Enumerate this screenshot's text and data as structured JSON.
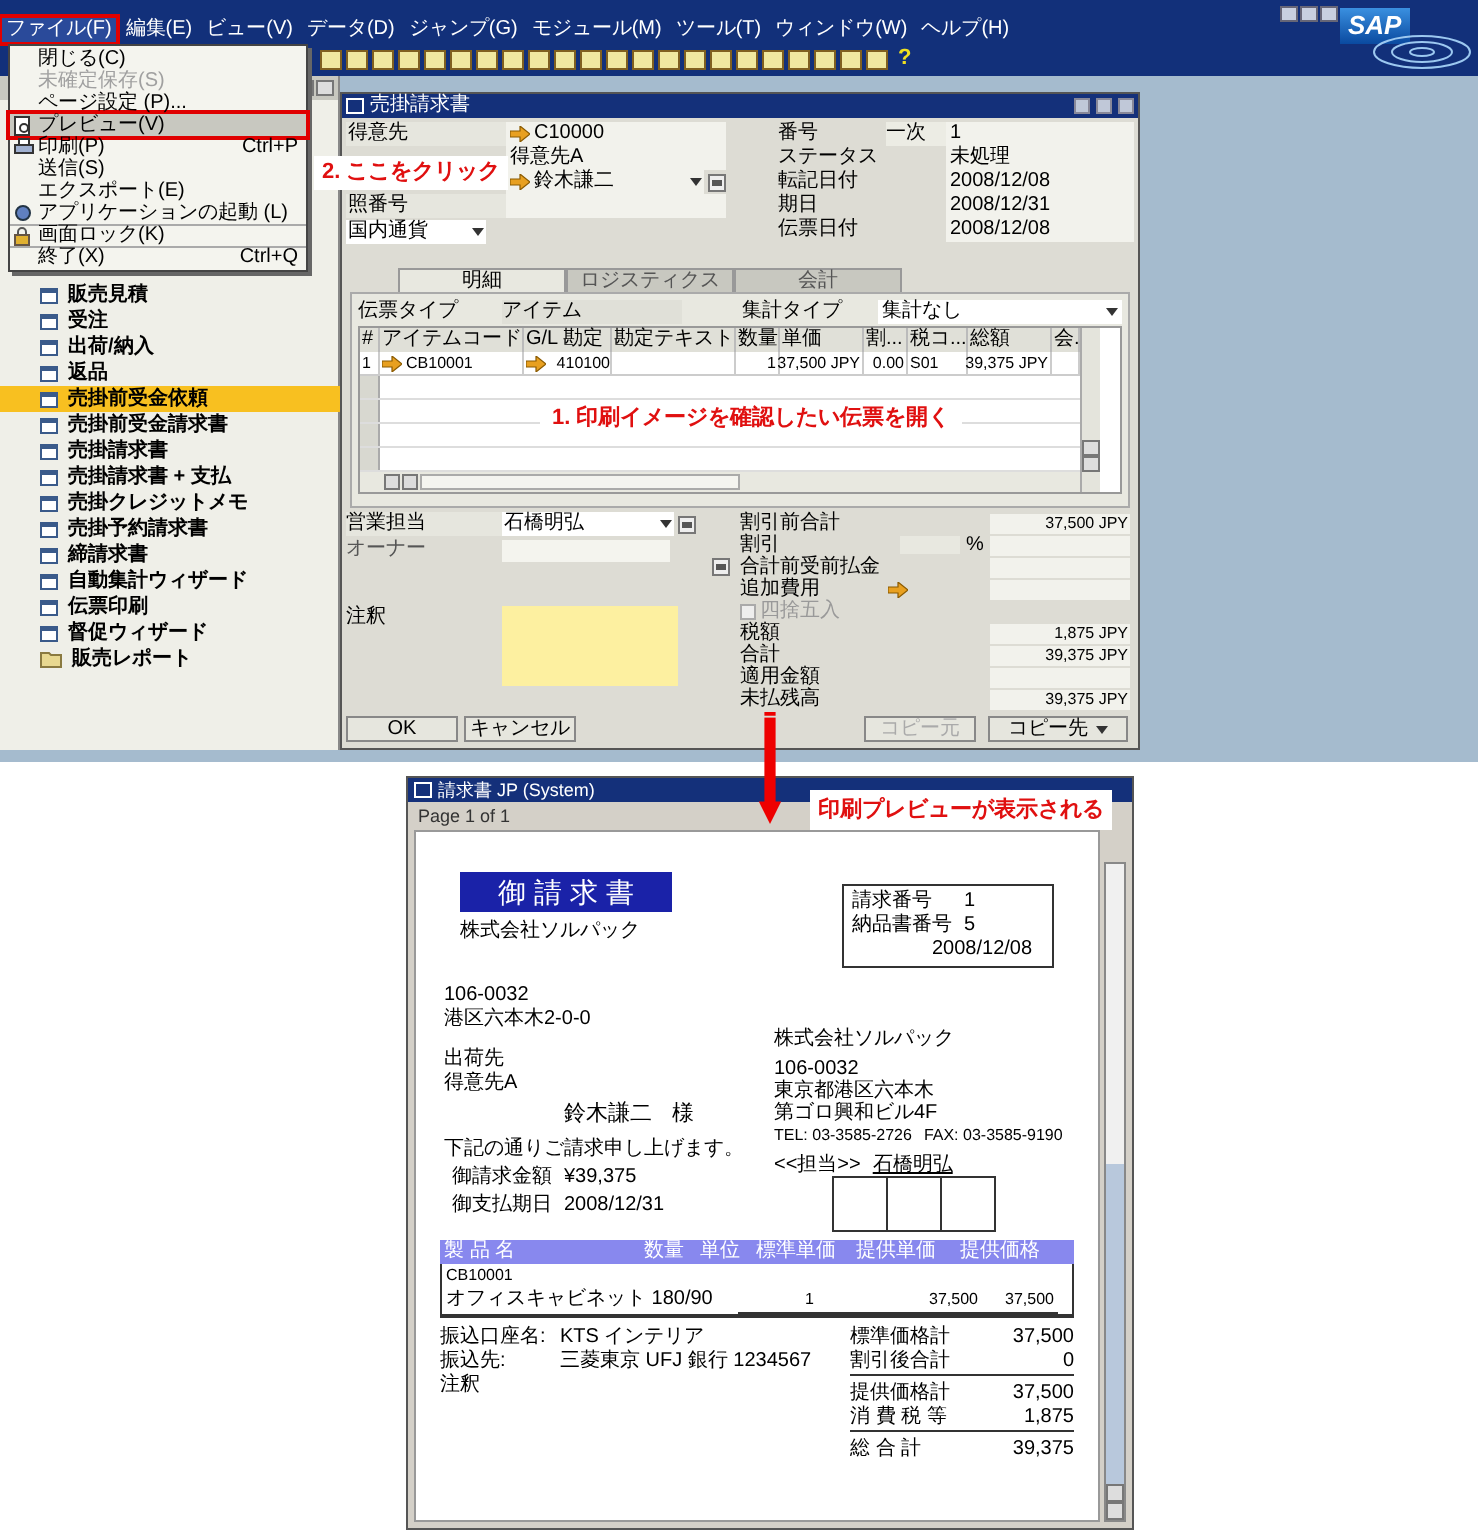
{
  "app": {
    "logo": "SAP",
    "help_glyph": "?",
    "menu": [
      {
        "label": "ファイル(F)",
        "selected": true
      },
      {
        "label": "編集(E)",
        "selected": false
      },
      {
        "label": "ビュー(V)",
        "selected": false
      },
      {
        "label": "データ(D)",
        "selected": false
      },
      {
        "label": "ジャンプ(G)",
        "selected": false
      },
      {
        "label": "モジュール(M)",
        "selected": false
      },
      {
        "label": "ツール(T)",
        "selected": false
      },
      {
        "label": "ウィンドウ(W)",
        "selected": false
      },
      {
        "label": "ヘルプ(H)",
        "selected": false
      }
    ],
    "file_menu": [
      {
        "label": "閉じる(C)",
        "kind": "plain",
        "disabled": false,
        "selected": false
      },
      {
        "label": "未確定保存(S)",
        "kind": "plain",
        "disabled": true,
        "selected": false
      },
      {
        "label": "ページ設定 (P)...",
        "kind": "plain",
        "disabled": false,
        "selected": false
      },
      {
        "label": "プレビュー(V)",
        "kind": "preview",
        "disabled": false,
        "selected": true
      },
      {
        "label": "印刷(P)",
        "shortcut": "Ctrl+P",
        "kind": "print",
        "disabled": false,
        "selected": false
      },
      {
        "label": "送信(S)",
        "kind": "plain",
        "disabled": false,
        "selected": false
      },
      {
        "label": "エクスポート(E)",
        "kind": "plain",
        "disabled": false,
        "selected": false
      },
      {
        "label": "アプリケーションの起動 (L)",
        "kind": "app",
        "disabled": false,
        "selected": false
      },
      {
        "label": "画面ロック(K)",
        "kind": "lock",
        "disabled": false,
        "selected": false
      },
      {
        "label": "終了(X)",
        "shortcut": "Ctrl+Q",
        "kind": "plain",
        "disabled": false,
        "selected": false
      }
    ],
    "sidebar": [
      {
        "label": "販売見積",
        "kind": "doc",
        "selected": false
      },
      {
        "label": "受注",
        "kind": "doc",
        "selected": false
      },
      {
        "label": "出荷/納入",
        "kind": "doc",
        "selected": false
      },
      {
        "label": "返品",
        "kind": "doc",
        "selected": false
      },
      {
        "label": "売掛前受金依頼",
        "kind": "doc",
        "selected": true
      },
      {
        "label": "売掛前受金請求書",
        "kind": "doc",
        "selected": false
      },
      {
        "label": "売掛請求書",
        "kind": "doc",
        "selected": false
      },
      {
        "label": "売掛請求書 + 支払",
        "kind": "doc",
        "selected": false
      },
      {
        "label": "売掛クレジットメモ",
        "kind": "doc",
        "selected": false
      },
      {
        "label": "売掛予約請求書",
        "kind": "doc",
        "selected": false
      },
      {
        "label": "締請求書",
        "kind": "doc",
        "selected": false
      },
      {
        "label": "自動集計ウィザード",
        "kind": "doc",
        "selected": false
      },
      {
        "label": "伝票印刷",
        "kind": "doc",
        "selected": false
      },
      {
        "label": "督促ウィザード",
        "kind": "doc",
        "selected": false
      },
      {
        "label": "販売レポート",
        "kind": "folder",
        "selected": false
      }
    ]
  },
  "invoice_window": {
    "title": "売掛請求書",
    "left_fields": [
      {
        "label": "得意先",
        "value": "C10000",
        "link": true
      },
      {
        "value": "得意先A",
        "link": false
      },
      {
        "value": "鈴木謙二",
        "link": true,
        "dropdown": true
      },
      {
        "label": "照番号",
        "link": false
      }
    ],
    "currency": "国内通貨",
    "right_fields": [
      {
        "label": "番号",
        "series": "一次",
        "value": "1"
      },
      {
        "label": "ステータス",
        "value": "未処理"
      },
      {
        "label": "転記日付",
        "value": "2008/12/08"
      },
      {
        "label": "期日",
        "value": "2008/12/31"
      },
      {
        "label": "伝票日付",
        "value": "2008/12/08"
      }
    ],
    "tabs": [
      {
        "label": "明細",
        "selected": true
      },
      {
        "label": "ロジスティクス",
        "selected": false
      },
      {
        "label": "会計",
        "selected": false
      }
    ],
    "doc_type_label": "伝票タイプ",
    "doc_type": "アイテム",
    "summary_type_label": "集計タイプ",
    "summary_type": "集計なし",
    "columns": [
      "#",
      "アイテムコード",
      "G/L 勘定",
      "勘定テキスト",
      "数量",
      "単価",
      "割...",
      "税コ...",
      "総額",
      "会."
    ],
    "rows": [
      {
        "cells": [
          "1",
          "CB10001",
          "410100",
          "",
          "1",
          "37,500 JPY",
          "0.00",
          "S01",
          "39,375 JPY",
          ""
        ]
      }
    ],
    "sales_rep_label": "営業担当",
    "sales_rep": "石橋明弘",
    "owner_label": "オーナー",
    "remarks_label": "注釈",
    "totals": [
      {
        "label": "割引前合計",
        "value": "37,500 JPY",
        "kind": "amount"
      },
      {
        "label": "割引",
        "unit": "%",
        "kind": "percent"
      },
      {
        "label": "合計前受前払金",
        "kind": "button"
      },
      {
        "label": "追加費用",
        "kind": "link"
      },
      {
        "label": "四捨五入",
        "checked": false,
        "kind": "check"
      },
      {
        "label": "税額",
        "value": "1,875 JPY",
        "kind": "amount"
      },
      {
        "label": "合計",
        "value": "39,375 JPY",
        "kind": "amount"
      },
      {
        "label": "適用金額",
        "kind": "amount"
      },
      {
        "label": "未払残高",
        "value": "39,375 JPY",
        "kind": "amount"
      }
    ],
    "buttons": [
      {
        "label": "OK",
        "disabled": false,
        "dropdown": false
      },
      {
        "label": "キャンセル",
        "disabled": false,
        "dropdown": false
      },
      {
        "label": "コピー元",
        "disabled": true,
        "dropdown": false
      },
      {
        "label": "コピー先",
        "disabled": false,
        "dropdown": true
      }
    ]
  },
  "annotations": [
    "2. ここをクリック",
    "1. 印刷イメージを確認したい伝票を開く",
    "印刷プレビューが表示される"
  ],
  "preview_window": {
    "title": "請求書 JP (System)",
    "page": "Page 1 of 1",
    "document": {
      "heading": "御 請 求 書",
      "sender_top": "株式会社ソルパック",
      "info": [
        {
          "label": "請求番号",
          "value": "1"
        },
        {
          "label": "納品書番号",
          "value": "5"
        },
        {
          "value": "2008/12/08"
        }
      ],
      "address": [
        "106-0032",
        "港区六本木2-0-0"
      ],
      "ship_label": "出荷先",
      "ship_to": "得意先A",
      "recipient": "鈴木謙二",
      "honorific": "様",
      "company": "株式会社ソルパック",
      "company_lines": [
        "106-0032",
        "東京都港区六本木",
        "第ゴロ興和ビル4F"
      ],
      "tel": "TEL:  03-3585-2726",
      "fax": "FAX:  03-3585-9190",
      "rep_label": "<<担当>>",
      "rep": "石橋明弘",
      "intro": "下記の通りご請求申し上げます。",
      "amount_label": "御請求金額",
      "amount": "¥39,375",
      "due_label": "御支払期日",
      "due": "2008/12/31",
      "columns": [
        "製 品 名",
        "数量",
        "単位",
        "標準単価",
        "提供単価",
        "提供価格"
      ],
      "items": [
        {
          "code": "CB10001",
          "name": "オフィスキャビネット 180/90",
          "qty": "1",
          "price": "37,500",
          "total": "37,500"
        }
      ],
      "bank": [
        {
          "label": "振込口座名:",
          "value": "KTS インテリア"
        },
        {
          "label": "振込先:",
          "value": "三菱東京 UFJ 銀行 1234567"
        }
      ],
      "remarks": "注釈",
      "totals": [
        {
          "label": "標準価格計",
          "value": "37,500"
        },
        {
          "label": "割引後合計",
          "value": "0"
        },
        {
          "label": "提供価格計",
          "value": "37,500"
        },
        {
          "label": "消 費 税 等",
          "value": "1,875"
        },
        {
          "label": "総 合 計",
          "value": "39,375"
        }
      ]
    }
  }
}
